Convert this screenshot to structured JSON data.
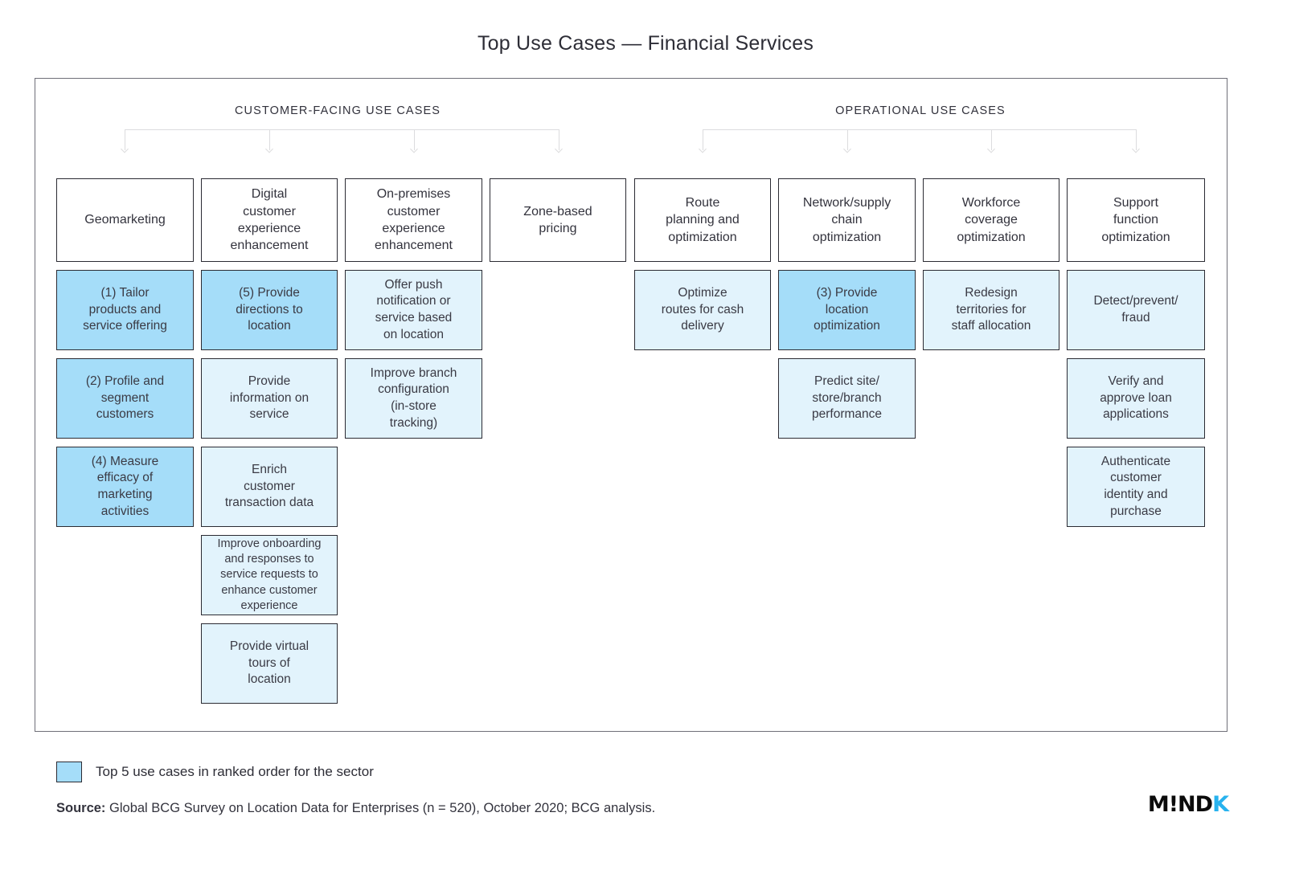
{
  "title": "Top Use Cases — Financial Services",
  "groups": {
    "customer": "CUSTOMER-FACING USE CASES",
    "operational": "OPERATIONAL USE CASES"
  },
  "legend": {
    "label": "Top 5 use cases in ranked order for the sector",
    "swatch_color": "#a5ddf9"
  },
  "source": {
    "label": "Source:",
    "text": " Global BCG Survey on Location Data for Enterprises (n = 520), October 2020; BCG analysis."
  },
  "brand": {
    "name": "M!ND",
    "accent": "K",
    "accent_color": "#27b2ee"
  },
  "colors": {
    "rank_fill": "#a5ddf9",
    "light_fill": "#e2f3fc",
    "border": "#2b2b33",
    "connector": "#dcdcde"
  },
  "columns": [
    {
      "group": "customer",
      "header": "Geomarketing",
      "items": [
        {
          "text": "(1) Tailor\nproducts and\nservice offering",
          "rank": 1,
          "style": "rank"
        },
        {
          "text": "(2) Profile and\nsegment\ncustomers",
          "rank": 2,
          "style": "rank"
        },
        {
          "text": "(4) Measure\nefficacy of\nmarketing\nactivities",
          "rank": 4,
          "style": "rank"
        }
      ]
    },
    {
      "group": "customer",
      "header": "Digital\ncustomer\nexperience\nenhancement",
      "items": [
        {
          "text": "(5) Provide\ndirections to\nlocation",
          "rank": 5,
          "style": "rank"
        },
        {
          "text": "Provide\ninformation on\nservice",
          "rank": null,
          "style": "light"
        },
        {
          "text": "Enrich\ncustomer\ntransaction data",
          "rank": null,
          "style": "light"
        },
        {
          "text": "Improve onboarding\nand responses to\nservice requests to\nenhance customer\nexperience",
          "rank": null,
          "style": "light tall5"
        },
        {
          "text": "Provide virtual\ntours of\nlocation",
          "rank": null,
          "style": "light"
        }
      ]
    },
    {
      "group": "customer",
      "header": "On-premises\ncustomer\nexperience\nenhancement",
      "items": [
        {
          "text": "Offer push\nnotification or\nservice based\non location",
          "rank": null,
          "style": "light"
        },
        {
          "text": "Improve branch\nconfiguration\n(in-store\ntracking)",
          "rank": null,
          "style": "light"
        }
      ]
    },
    {
      "group": "customer",
      "header": "Zone-based\npricing",
      "items": []
    },
    {
      "group": "operational",
      "header": "Route\nplanning and\noptimization",
      "items": [
        {
          "text": "Optimize\nroutes for cash\ndelivery",
          "rank": null,
          "style": "light"
        }
      ]
    },
    {
      "group": "operational",
      "header": "Network/supply\nchain\noptimization",
      "items": [
        {
          "text": "(3) Provide\nlocation\noptimization",
          "rank": 3,
          "style": "rank"
        },
        {
          "text": "Predict site/\nstore/branch\nperformance",
          "rank": null,
          "style": "light"
        }
      ]
    },
    {
      "group": "operational",
      "header": "Workforce\ncoverage\noptimization",
      "items": [
        {
          "text": "Redesign\nterritories for\nstaff allocation",
          "rank": null,
          "style": "light"
        }
      ]
    },
    {
      "group": "operational",
      "header": "Support\nfunction\noptimization",
      "items": [
        {
          "text": "Detect/prevent/\nfraud",
          "rank": null,
          "style": "light"
        },
        {
          "text": "Verify and\napprove loan\napplications",
          "rank": null,
          "style": "light"
        },
        {
          "text": "Authenticate\ncustomer\nidentity and\npurchase",
          "rank": null,
          "style": "light"
        }
      ]
    }
  ]
}
